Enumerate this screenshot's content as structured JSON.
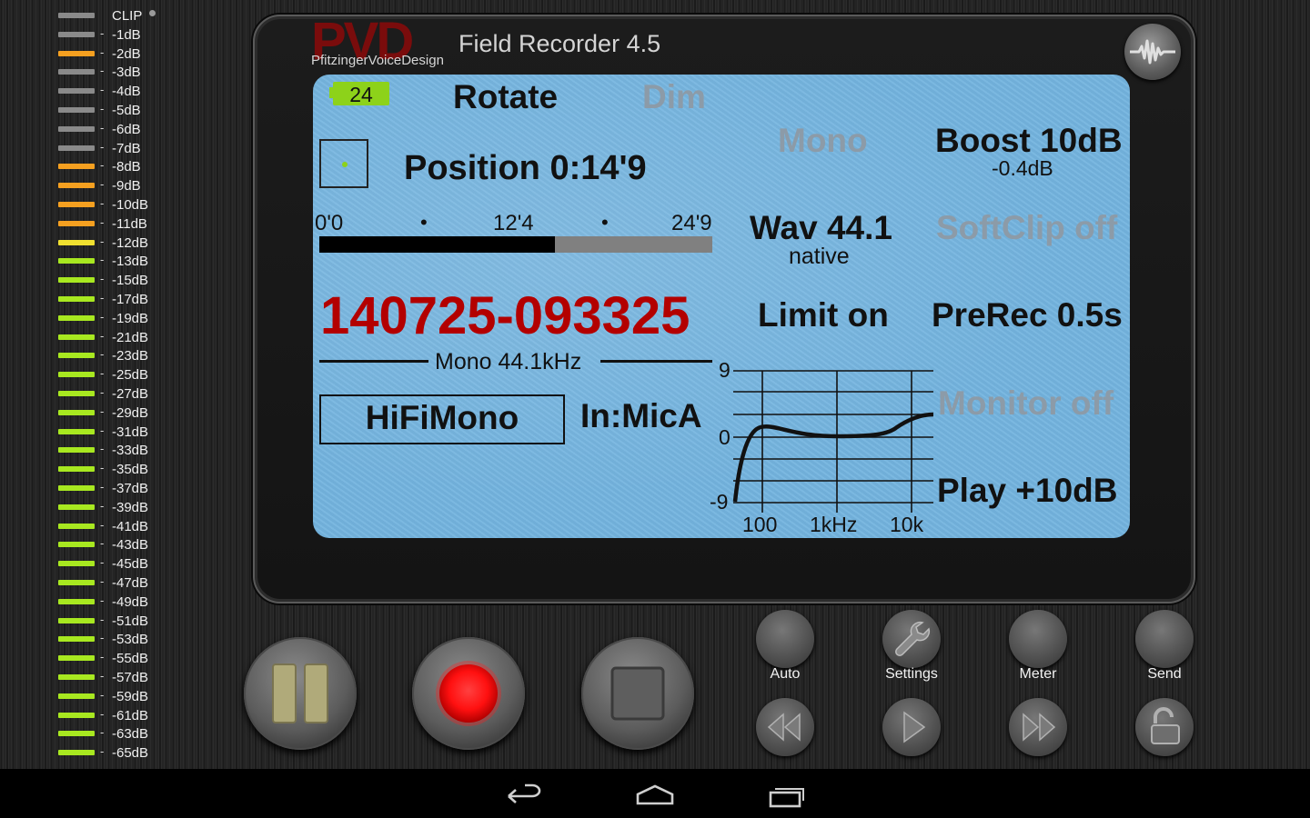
{
  "meter": {
    "rows": [
      {
        "label": "CLIP",
        "color": "#8a8a8a"
      },
      {
        "label": "-1dB",
        "color": "#8a8a8a"
      },
      {
        "label": "-2dB",
        "color": "#f5a020"
      },
      {
        "label": "-3dB",
        "color": "#8a8a8a"
      },
      {
        "label": "-4dB",
        "color": "#8a8a8a"
      },
      {
        "label": "-5dB",
        "color": "#8a8a8a"
      },
      {
        "label": "-6dB",
        "color": "#8a8a8a"
      },
      {
        "label": "-7dB",
        "color": "#8a8a8a"
      },
      {
        "label": "-8dB",
        "color": "#f5a020"
      },
      {
        "label": "-9dB",
        "color": "#f5a020"
      },
      {
        "label": "-10dB",
        "color": "#f5a020"
      },
      {
        "label": "-11dB",
        "color": "#f5a020"
      },
      {
        "label": "-12dB",
        "color": "#f0e030"
      },
      {
        "label": "-13dB",
        "color": "#a8e820"
      },
      {
        "label": "-15dB",
        "color": "#a8e820"
      },
      {
        "label": "-17dB",
        "color": "#a8e820"
      },
      {
        "label": "-19dB",
        "color": "#a8e820"
      },
      {
        "label": "-21dB",
        "color": "#a8e820"
      },
      {
        "label": "-23dB",
        "color": "#a8e820"
      },
      {
        "label": "-25dB",
        "color": "#a8e820"
      },
      {
        "label": "-27dB",
        "color": "#a8e820"
      },
      {
        "label": "-29dB",
        "color": "#a8e820"
      },
      {
        "label": "-31dB",
        "color": "#a8e820"
      },
      {
        "label": "-33dB",
        "color": "#a8e820"
      },
      {
        "label": "-35dB",
        "color": "#a8e820"
      },
      {
        "label": "-37dB",
        "color": "#a8e820"
      },
      {
        "label": "-39dB",
        "color": "#a8e820"
      },
      {
        "label": "-41dB",
        "color": "#a8e820"
      },
      {
        "label": "-43dB",
        "color": "#a8e820"
      },
      {
        "label": "-45dB",
        "color": "#a8e820"
      },
      {
        "label": "-47dB",
        "color": "#a8e820"
      },
      {
        "label": "-49dB",
        "color": "#a8e820"
      },
      {
        "label": "-51dB",
        "color": "#a8e820"
      },
      {
        "label": "-53dB",
        "color": "#a8e820"
      },
      {
        "label": "-55dB",
        "color": "#a8e820"
      },
      {
        "label": "-57dB",
        "color": "#a8e820"
      },
      {
        "label": "-59dB",
        "color": "#a8e820"
      },
      {
        "label": "-61dB",
        "color": "#a8e820"
      },
      {
        "label": "-63dB",
        "color": "#a8e820"
      },
      {
        "label": "-65dB",
        "color": "#a8e820"
      }
    ],
    "dash": "-"
  },
  "header": {
    "logo_letters": "PVD",
    "logo_subtitle": "PfitzingerVoiceDesign",
    "title": "Field Recorder 4.5",
    "wave_icon": "waveform-icon"
  },
  "display": {
    "battery": "24",
    "rotate": "Rotate",
    "dim": "Dim",
    "position": "Position 0:14'9",
    "timeline": {
      "start": "0'0",
      "mid": "12'4",
      "end": "24'9",
      "dot": "•",
      "progress": 0.6
    },
    "filename": "140725-093325",
    "format": "Mono 44.1kHz",
    "preset": "HiFiMono",
    "input": "In:MicA",
    "mono": "Mono",
    "boost": "Boost 10dB",
    "boost_value": "-0.4dB",
    "wav": "Wav 44.1",
    "wav_sub": "native",
    "softclip": "SoftClip off",
    "limit": "Limit on",
    "prerec": "PreRec 0.5s",
    "monitor": "Monitor off",
    "play": "Play +10dB",
    "eq": {
      "y_labels": [
        "9",
        "0",
        "-9"
      ],
      "x_labels": [
        "100",
        "1kHz",
        "10k"
      ]
    }
  },
  "transport": {
    "pause_icon": "pause-icon",
    "record_icon": "record-icon",
    "stop_icon": "stop-icon",
    "record_color": "#ff1a1a"
  },
  "controls": {
    "auto": "Auto",
    "settings": "Settings",
    "meter": "Meter",
    "send": "Send",
    "rewind_icon": "rewind-icon",
    "play_icon": "play-icon",
    "forward_icon": "fast-forward-icon",
    "lock_icon": "unlock-icon"
  },
  "navbar": {
    "back_icon": "back-icon",
    "home_icon": "home-icon",
    "recents_icon": "recents-icon"
  },
  "colors": {
    "lcd": "#74b4df",
    "filename_red": "#b30000",
    "battery_green": "#8dd21a"
  }
}
